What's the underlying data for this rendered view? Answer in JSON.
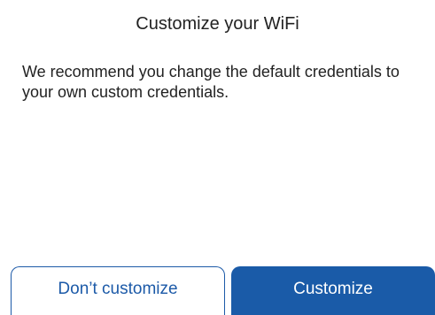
{
  "dialog": {
    "title": "Customize your WiFi",
    "message": "We recommend you change the default credentials to your own custom credentials.",
    "buttons": {
      "secondary_label": "Don’t customize",
      "primary_label": "Customize"
    }
  },
  "colors": {
    "accent": "#1a5ba8",
    "text": "#222222",
    "background": "#ffffff"
  }
}
